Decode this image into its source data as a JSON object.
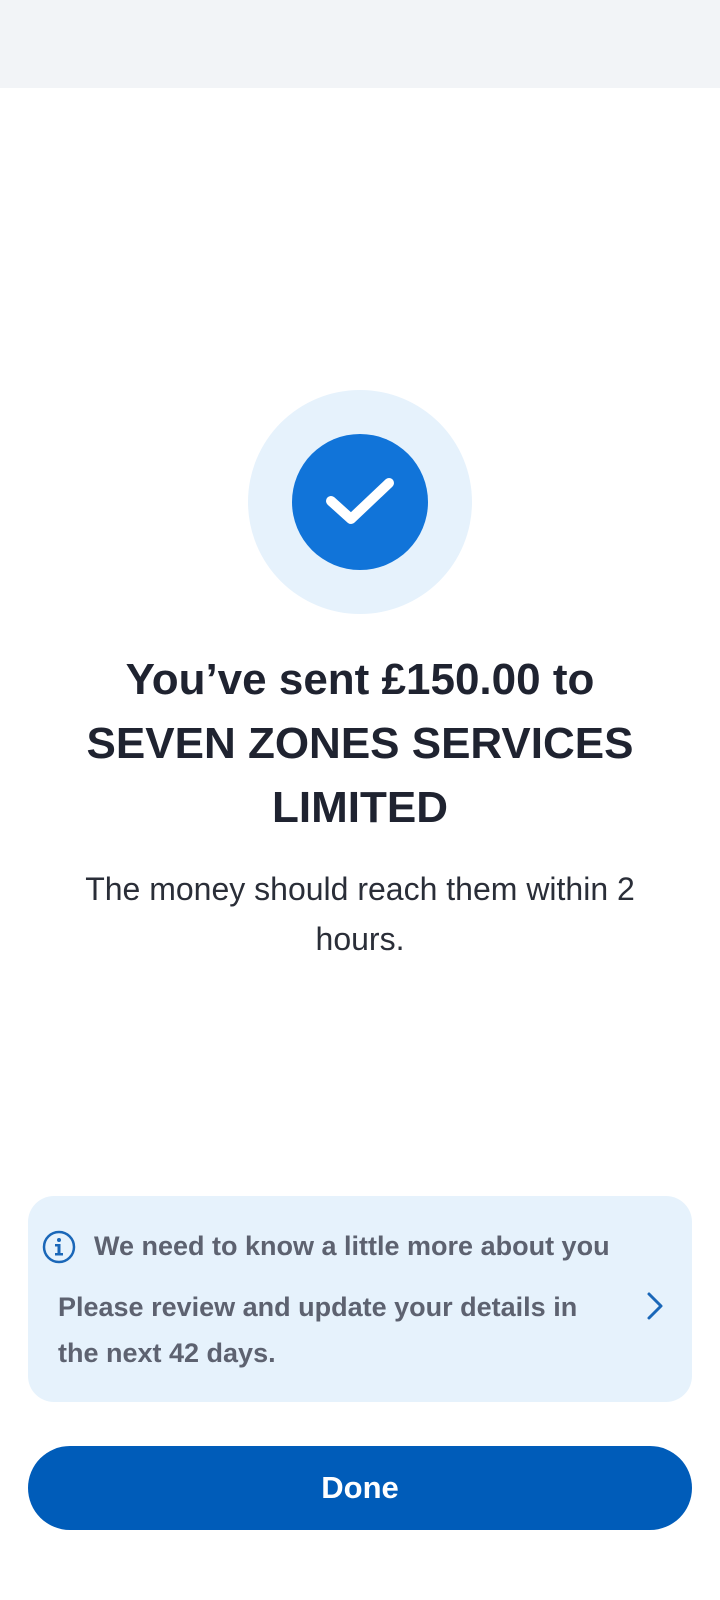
{
  "confirmation": {
    "headline": "You’ve sent £150.00 to SEVEN ZONES SERVICES LIMITED",
    "subtext": "The money should reach them within 2 hours.",
    "icon": "checkmark-icon"
  },
  "info_card": {
    "icon": "info-icon",
    "title": "We need to know a little more about you",
    "body": "Please review and update your details in the next 42 days.",
    "action_icon": "chevron-right-icon"
  },
  "footer": {
    "done_label": "Done"
  },
  "colors": {
    "primary": "#005cb9",
    "check_blue": "#1174d9",
    "light_blue": "#e6f2fc",
    "status_bar": "#f2f4f7"
  }
}
